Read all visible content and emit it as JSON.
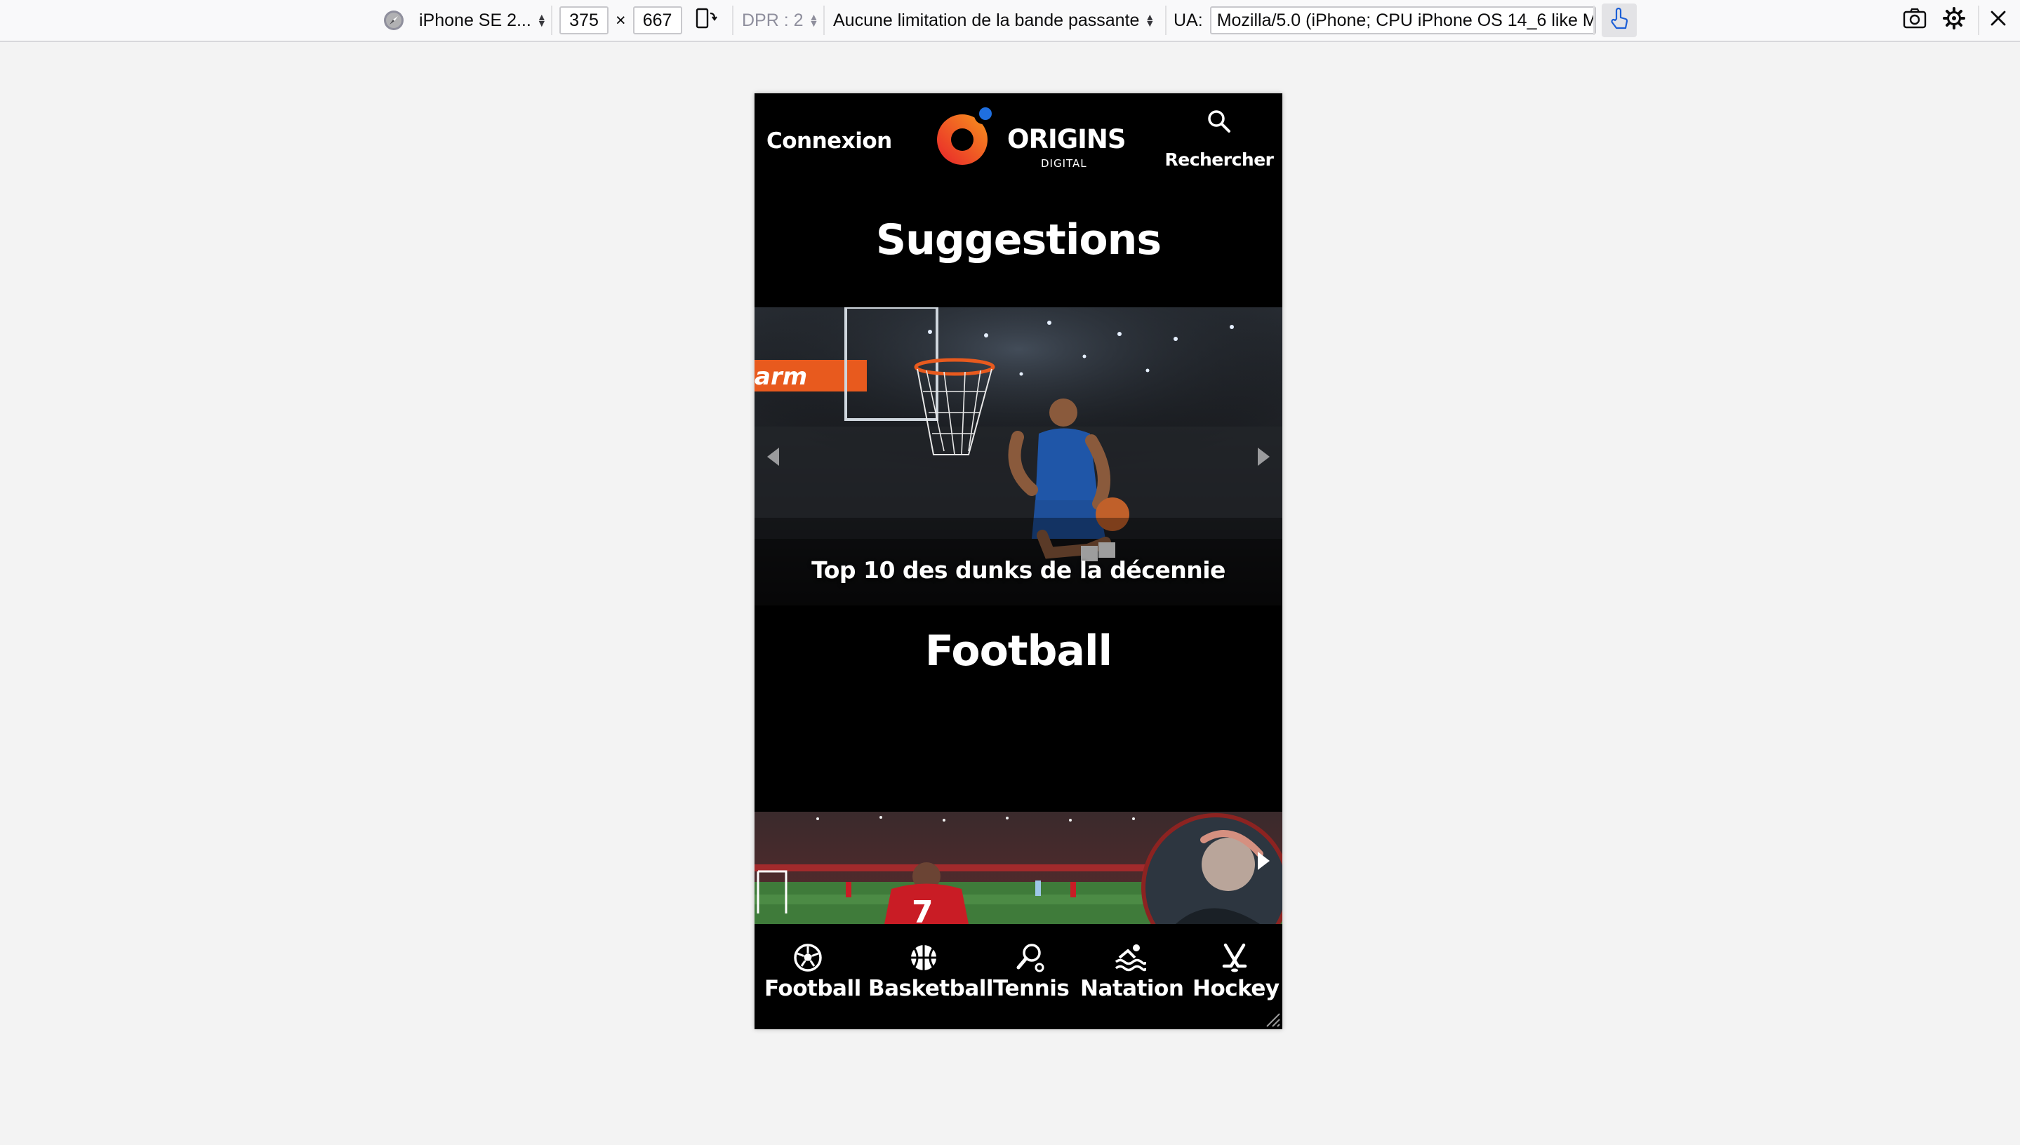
{
  "devtools": {
    "device_name": "iPhone SE 2...",
    "width": "375",
    "times": "×",
    "height": "667",
    "dpr": "DPR : 2",
    "throttling": "Aucune limitation de la bande passante",
    "ua_label": "UA:",
    "ua_value": "Mozilla/5.0 (iPhone; CPU iPhone OS 14_6 like M",
    "icons": [
      "compass-icon",
      "rotate-icon",
      "touch-icon",
      "camera-icon",
      "gear-icon",
      "close-icon"
    ]
  },
  "header": {
    "login": "Connexion",
    "logo_word": "ORIGINS",
    "logo_sub": "DIGITAL",
    "search_label": "Rechercher"
  },
  "sections": [
    {
      "title": "Suggestions",
      "caption": "Top 10 des dunks de la décennie"
    },
    {
      "title": "Football"
    }
  ],
  "bottom_nav": [
    {
      "label": "Football",
      "icon": "soccer-ball-icon"
    },
    {
      "label": "Basketball",
      "icon": "basketball-icon"
    },
    {
      "label": "Tennis",
      "icon": "tennis-racket-icon"
    },
    {
      "label": "Natation",
      "icon": "swimming-icon"
    },
    {
      "label": "Hockey",
      "icon": "hockey-sticks-icon"
    }
  ],
  "colors": {
    "brand_orange": "#f26522",
    "brand_red": "#e8232b",
    "brand_blue": "#1f6fe0",
    "toolbar_bg": "#f9f9fa",
    "page_bg": "#f3f3f3"
  }
}
